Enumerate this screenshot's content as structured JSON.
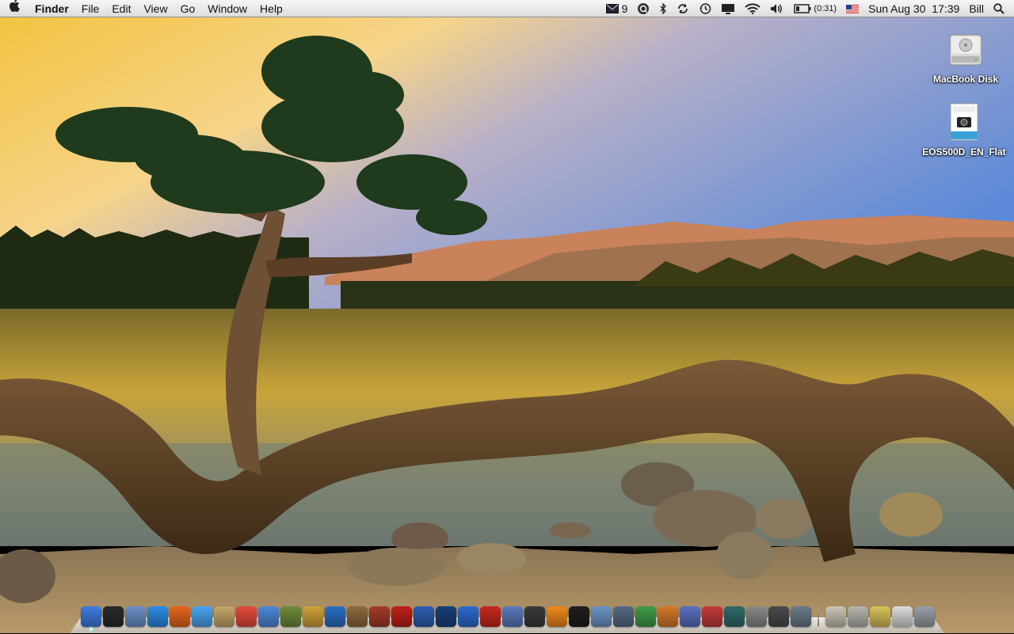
{
  "menubar": {
    "app_name": "Finder",
    "menus": [
      "File",
      "Edit",
      "View",
      "Go",
      "Window",
      "Help"
    ],
    "mail_count": "9",
    "battery_time": "(0:31)",
    "datetime": "Sun Aug 30  17:39",
    "user": "Bill"
  },
  "desktop": {
    "icons": [
      {
        "label": "MacBook Disk",
        "icon": "hard-disk-icon"
      },
      {
        "label": "EOS500D_EN_Flat",
        "icon": "pdf-document-icon"
      }
    ]
  },
  "dock": {
    "apps": [
      {
        "name": "finder",
        "color": "#3d7de0"
      },
      {
        "name": "dashboard",
        "color": "#2a2a2a"
      },
      {
        "name": "preview",
        "color": "#6b8fc9"
      },
      {
        "name": "safari",
        "color": "#2e8be6"
      },
      {
        "name": "firefox",
        "color": "#e8661c"
      },
      {
        "name": "ichat",
        "color": "#4aa4ef"
      },
      {
        "name": "address-book",
        "color": "#c8a86a"
      },
      {
        "name": "ical",
        "color": "#e64b3c"
      },
      {
        "name": "itunes",
        "color": "#4d89d9"
      },
      {
        "name": "iphoto",
        "color": "#6e8c3a"
      },
      {
        "name": "star-app",
        "color": "#d0a23a"
      },
      {
        "name": "dvd-player",
        "color": "#2a6fc4"
      },
      {
        "name": "paintbrush",
        "color": "#8c6a3c"
      },
      {
        "name": "photo-booth",
        "color": "#a33a2a"
      },
      {
        "name": "flash-card",
        "color": "#c0201a"
      },
      {
        "name": "network-app",
        "color": "#2b5fb0"
      },
      {
        "name": "photoshop",
        "color": "#1a3f7a"
      },
      {
        "name": "google-earth",
        "color": "#2d6bd1"
      },
      {
        "name": "cross-app",
        "color": "#c8281e"
      },
      {
        "name": "maps-app",
        "color": "#5a7bbf"
      },
      {
        "name": "quicktime",
        "color": "#3b3b3b"
      },
      {
        "name": "vlc",
        "color": "#f08a1a"
      },
      {
        "name": "front-row",
        "color": "#1e1e1e"
      },
      {
        "name": "script-editor",
        "color": "#6a94c6"
      },
      {
        "name": "calculator-tool",
        "color": "#556a84"
      },
      {
        "name": "activity-monitor",
        "color": "#3f9c4a"
      },
      {
        "name": "mail-stamp",
        "color": "#d57a2a"
      },
      {
        "name": "imovie",
        "color": "#5b6fbf"
      },
      {
        "name": "garageband",
        "color": "#c43a3a"
      },
      {
        "name": "time-machine",
        "color": "#2f6a6a"
      },
      {
        "name": "system-preferences",
        "color": "#8a8a8a"
      },
      {
        "name": "screenshot-app",
        "color": "#4a4a4a"
      },
      {
        "name": "printer",
        "color": "#6a7a8a"
      }
    ],
    "stacks": [
      {
        "name": "applications-stack",
        "color": "#c9c6b8"
      },
      {
        "name": "documents-stack",
        "color": "#b7b5ad"
      },
      {
        "name": "downloads-stack",
        "color": "#d8c25a"
      },
      {
        "name": "mail-stack",
        "color": "#dcdcdc"
      },
      {
        "name": "trash",
        "color": "#9aa0a8"
      }
    ]
  }
}
